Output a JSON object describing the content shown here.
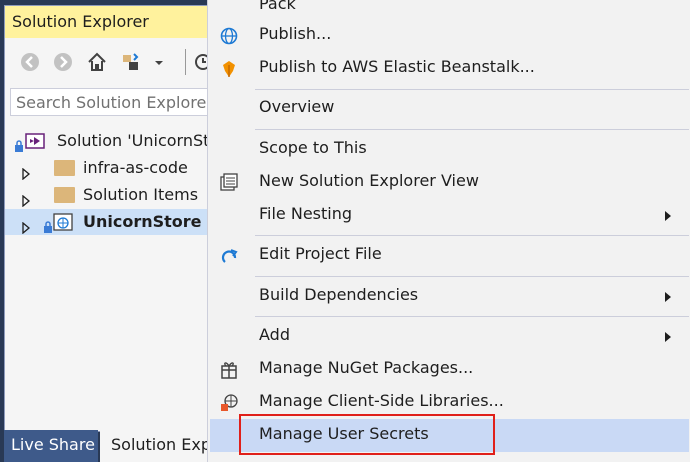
{
  "solution_explorer": {
    "title": "Solution Explorer",
    "search_placeholder": "Search Solution Explorer",
    "tree": [
      {
        "label": "Solution 'UnicornStore'",
        "bold": false
      },
      {
        "label": "infra-as-code",
        "bold": false
      },
      {
        "label": "Solution Items",
        "bold": false
      },
      {
        "label": "UnicornStore",
        "bold": true,
        "selected": true
      }
    ],
    "tabs": {
      "live_share": "Live Share",
      "solution_explorer": "Solution Explorer"
    }
  },
  "context_menu": {
    "items": {
      "pack": "Pack",
      "publish": "Publish...",
      "publish_aws": "Publish to AWS Elastic Beanstalk...",
      "overview": "Overview",
      "scope_to_this": "Scope to This",
      "new_view": "New Solution Explorer View",
      "file_nesting": "File Nesting",
      "edit_project_file": "Edit Project File",
      "build_dependencies": "Build Dependencies",
      "add": "Add",
      "manage_nuget": "Manage NuGet Packages...",
      "manage_client_libs": "Manage Client-Side Libraries...",
      "manage_user_secrets": "Manage User Secrets"
    }
  },
  "colors": {
    "background": "#293955",
    "title_highlight": "#fff29d",
    "menu_highlight": "#c9d9f5",
    "callout_border": "#e0201a",
    "live_share_tab": "#3e5a8a"
  }
}
